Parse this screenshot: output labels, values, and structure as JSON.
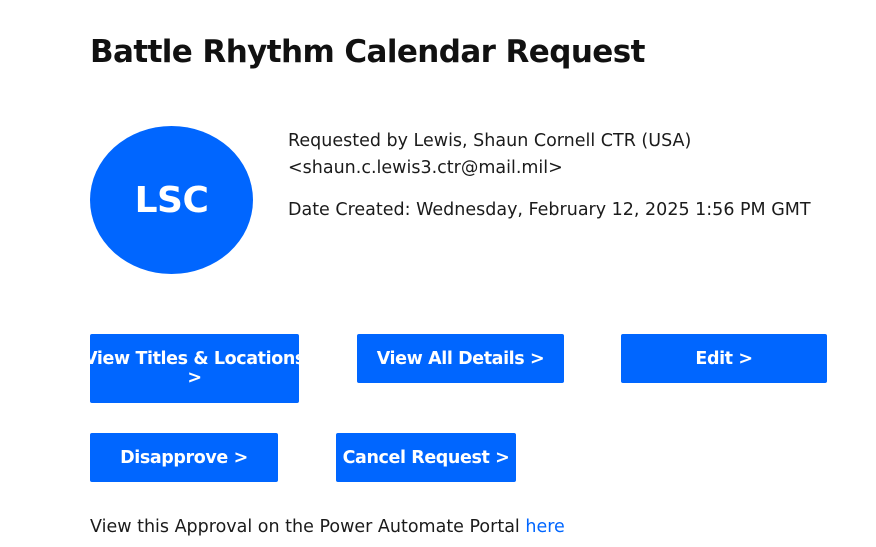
{
  "title": "Battle Rhythm Calendar Request",
  "avatar": {
    "initials": "LSC",
    "color": "#0066ff"
  },
  "requester": {
    "line1": "Requested by Lewis, Shaun Cornell CTR (USA)",
    "line2": "<shaun.c.lewis3.ctr@mail.mil>"
  },
  "date_created": "Date Created: Wednesday, February 12, 2025 1:56 PM GMT",
  "buttons": {
    "view_titles_line1": "View Titles & Locations",
    "view_titles_line2": ">",
    "view_all_details": "View All Details >",
    "edit": "Edit >",
    "disapprove": "Disapprove >",
    "cancel_request": "Cancel Request >"
  },
  "footer": {
    "text": "View this Approval on the Power Automate Portal",
    "link_label": "here"
  },
  "colors": {
    "accent": "#0066ff",
    "text": "#1b1b1b",
    "background": "#ffffff"
  }
}
